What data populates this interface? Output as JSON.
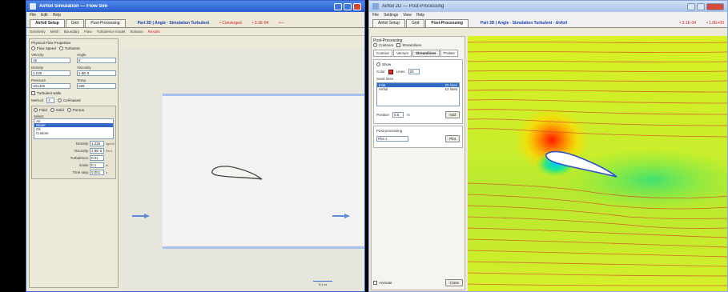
{
  "left_window": {
    "title": "Airfoil Simulation — Flow Sim",
    "menu": [
      "File",
      "Edit",
      "Help"
    ],
    "tabs": [
      "Airfoil Setup",
      "Grid",
      "Post-Processing"
    ],
    "active_tab": 0,
    "info": "Part 3D | Angle · Simulation Turbulent",
    "red_status": [
      "• Converged",
      "• 3.1E-04",
      "•—"
    ],
    "subtoolbar": [
      "Geometry",
      "Mesh",
      "Boundary",
      "Flow",
      "Turbulence model",
      "Solution",
      "Results"
    ],
    "props": {
      "group_title": "Physical Flow Properties",
      "radio_a": "Flow Speed",
      "radio_b": "Turbulent",
      "fields": [
        {
          "label": "Velocity",
          "value": "15"
        },
        {
          "label": "Angle",
          "value": "8"
        },
        {
          "label": "Density",
          "value": "1.225"
        },
        {
          "label": "Viscosity",
          "value": "1.8E-5"
        },
        {
          "label": "Pressure",
          "value": "101325"
        },
        {
          "label": "Temp.",
          "value": "288"
        }
      ],
      "check_label": "Turbulent walls",
      "method_label": "Method",
      "method_value": "1",
      "method_opt": "Cell-based",
      "sub_opts": [
        "Fluid",
        "Solid",
        "Porous"
      ],
      "list_title": "Select",
      "list_items": [
        "Air",
        "Water",
        "Oil",
        "Custom"
      ],
      "list_selected": 1,
      "params": [
        {
          "label": "Density",
          "value": "1.225",
          "unit": "kg/m3"
        },
        {
          "label": "Viscosity",
          "value": "1.8E-5",
          "unit": "Pa s"
        },
        {
          "label": "Turbulence",
          "value": "0.01",
          "unit": ""
        },
        {
          "label": "Scale",
          "value": "0.1",
          "unit": "m"
        },
        {
          "label": "Time step",
          "value": "0.001",
          "unit": "s"
        }
      ]
    },
    "scale_label": "0.1 m"
  },
  "right_window": {
    "title": "Airfoil 2D — Post-Processing",
    "menu": [
      "File",
      "Settings",
      "View",
      "Help"
    ],
    "tabs": [
      "Airfoil Setup",
      "Grid",
      "Post-Processing"
    ],
    "active_tab": 2,
    "info": "Part 3D | Angle · Simulation Turbulent · Airfoil",
    "red_status": [
      "• 3.1E-04",
      "• 1.0E+00"
    ],
    "panel": {
      "title": "Post-Processing",
      "options": [
        "Contours",
        "Streamlines"
      ],
      "rtabs": [
        "Contour",
        "Vectors",
        "Streamlines",
        "Probes"
      ],
      "active_rtab": 2,
      "show_label": "Show",
      "color_label": "Color",
      "lines_label": "Lines",
      "lines_value": "20",
      "seeds_title": "Seed lines",
      "seeds": [
        {
          "name": "Inlet",
          "value": "20 lines"
        },
        {
          "name": "Airfoil",
          "value": "12 lines"
        }
      ],
      "seeds_selected": 0,
      "position_label": "Position",
      "position_value": "0.5",
      "position_unit": "m",
      "add_button": "Add",
      "plot_title": "Post-processing",
      "plot_value": "Plot 1",
      "plot_button": "Plot",
      "checkbox_label": "Animate",
      "close_button": "Close"
    }
  }
}
